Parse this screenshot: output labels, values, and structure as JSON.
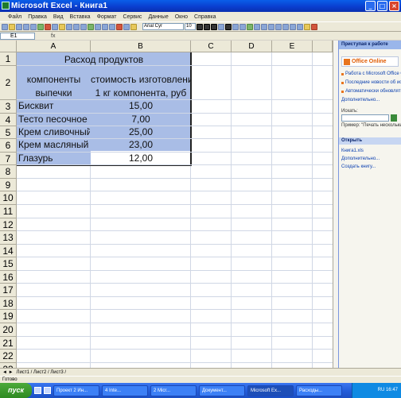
{
  "window": {
    "title": "Microsoft Excel - Книга1"
  },
  "menu": [
    "Файл",
    "Правка",
    "Вид",
    "Вставка",
    "Формат",
    "Сервис",
    "Данные",
    "Окно",
    "Справка"
  ],
  "toolbar": {
    "font_name": "Arial Cyr",
    "font_size": "10"
  },
  "formula_bar": {
    "cell_ref": "E1",
    "fx": "fx",
    "value": ""
  },
  "columns": [
    "A",
    "B",
    "C",
    "D",
    "E"
  ],
  "rows": [
    "1",
    "2",
    "3",
    "4",
    "5",
    "6",
    "7",
    "8",
    "9",
    "10",
    "11",
    "12",
    "13",
    "14",
    "15",
    "16",
    "17",
    "18",
    "19",
    "20",
    "21",
    "22",
    "23"
  ],
  "sheet": {
    "title": "Расход продуктов",
    "header_a": [
      "компоненты",
      "выпечки"
    ],
    "header_b": [
      "стоимость изготовления",
      "1 кг компонента, руб"
    ],
    "items": [
      {
        "name": "Бисквит",
        "cost": "15,00"
      },
      {
        "name": "Тесто песочное",
        "cost": "7,00"
      },
      {
        "name": "Крем сливочный",
        "cost": "25,00"
      },
      {
        "name": "Крем масляный",
        "cost": "23,00"
      },
      {
        "name": "Глазурь",
        "cost": "12,00"
      }
    ]
  },
  "task_pane": {
    "title": "Приступая к работе",
    "logo": "Office Online",
    "links": [
      "Работа с Microsoft Office Online",
      "Последние новости об использовании Excel",
      "Автоматически обновлять этот список из Интернета"
    ],
    "more": "Дополнительно...",
    "search_label": "Искать:",
    "example": "Пример: \"Печать нескольких копий\"",
    "open_section": "Открыть",
    "files": [
      "Книга1.xls",
      "Дополнительно...",
      "Создать книгу..."
    ]
  },
  "sheet_tabs": "Лист1 / Лист2 / Лист3 /",
  "status": "Готово",
  "taskbar": {
    "start": "пуск",
    "buttons": [
      "Проект 2 Ин...",
      "4 Inte...",
      "2 Micr...",
      "Документ...",
      "Microsoft Ex...",
      "Расходы..."
    ],
    "clock": "RU 16:47"
  }
}
